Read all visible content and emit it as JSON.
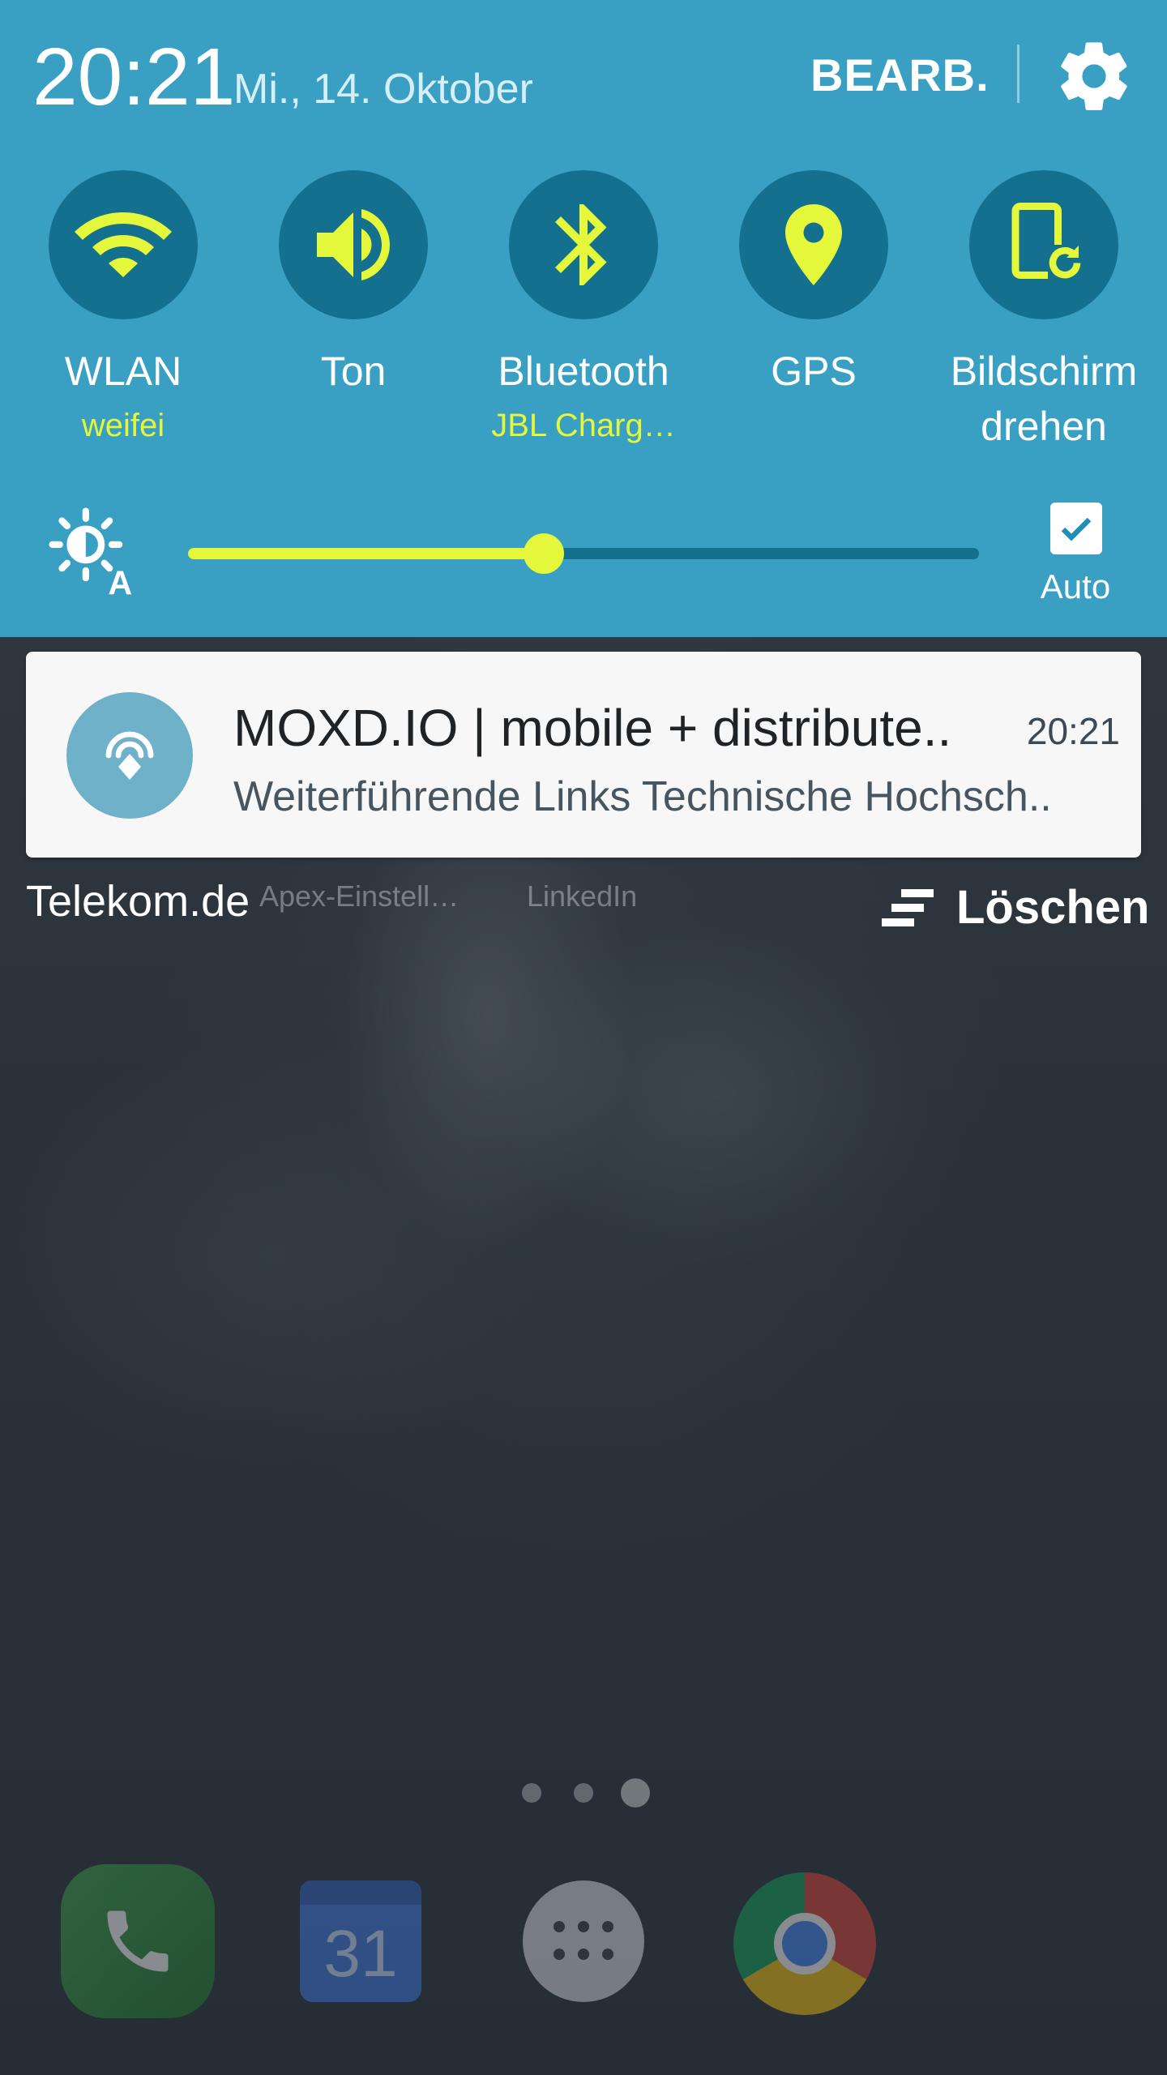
{
  "status": {
    "time": "20:21",
    "date": "Mi., 14. Oktober",
    "edit_label": "BEARB."
  },
  "quick_toggles": [
    {
      "label": "WLAN",
      "sub": "weifei",
      "icon": "wifi-icon"
    },
    {
      "label": "Ton",
      "sub": "",
      "icon": "speaker-icon"
    },
    {
      "label": "Bluetooth",
      "sub": "JBL Charg…",
      "icon": "bluetooth-icon"
    },
    {
      "label": "GPS",
      "sub": "",
      "icon": "location-pin-icon"
    },
    {
      "label": "Bildschirm",
      "sub": "drehen",
      "icon": "screen-rotation-icon"
    }
  ],
  "brightness": {
    "level": 0.45,
    "auto_label": "Auto",
    "auto_checked": true
  },
  "notification": {
    "title": "MOXD.IO | mobile + distribute..",
    "time": "20:21",
    "text": "Weiterführende Links Technische Hochsch.."
  },
  "clear_label": "Löschen",
  "home": {
    "shortcut_labels": [
      "Telekom.de",
      "Apex-Einstell…",
      "LinkedIn"
    ],
    "page_count": 3,
    "current_page": 3,
    "calendar_day": "31",
    "dock_apps": [
      "phone-app",
      "calendar-app",
      "apps-drawer",
      "chrome-app"
    ]
  },
  "colors": {
    "panel": "#3aa0c3",
    "toggle_circle": "#14708f",
    "accent": "#e4f73a"
  }
}
